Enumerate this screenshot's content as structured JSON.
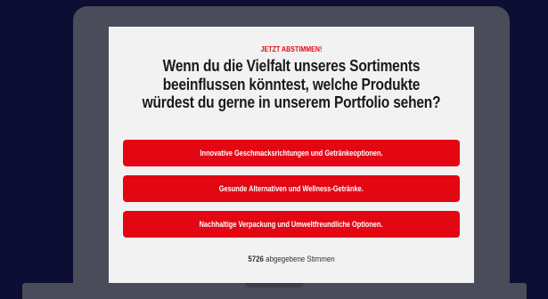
{
  "poll": {
    "kicker": "JETZT ABSTIMMEN!",
    "question_lines": [
      "Wenn du die Vielfalt unseres Sortiments",
      "beeinflussen könntest, welche Produkte",
      "würdest du gerne in unserem Portfolio sehen?"
    ],
    "options": [
      {
        "label": "Innovative Geschmacksrichtungen und Getränkeoptionen."
      },
      {
        "label": "Gesunde Alternativen und Wellness-Getränke."
      },
      {
        "label": "Nachhaltige Verpackung und Umweltfreundliche Optionen."
      }
    ],
    "votes": {
      "count": "5726",
      "label": "abgegebene Stimmen"
    }
  },
  "colors": {
    "background": "#0c0e33",
    "laptop_frame": "#4a4c5a",
    "screen": "#f2f2f2",
    "accent_red": "#e30613",
    "question_text": "#1a1a1a"
  }
}
